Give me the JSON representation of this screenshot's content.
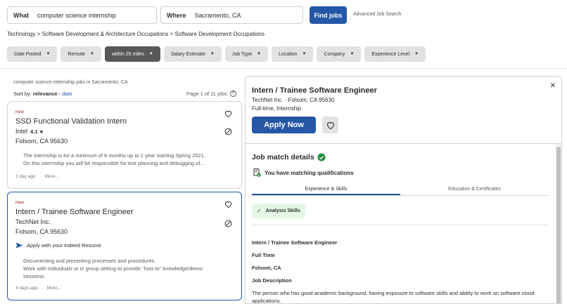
{
  "search": {
    "what_label": "What",
    "what_value": "computer science internship",
    "where_label": "Where",
    "where_value": "Sacramento, CA",
    "find_button": "Find jobs",
    "advanced_link": "Advanced Job Search"
  },
  "breadcrumb": "Technology > Software Development & Architecture Occupations > Software Development Occupations",
  "filters": [
    {
      "label": "Date Posted"
    },
    {
      "label": "Remote"
    },
    {
      "label": "within 25 miles"
    },
    {
      "label": "Salary Estimate"
    },
    {
      "label": "Job Type"
    },
    {
      "label": "Location"
    },
    {
      "label": "Company"
    },
    {
      "label": "Experience Level"
    }
  ],
  "results": {
    "title": "computer science internship jobs in Sacramento, CA",
    "sort_prefix": "Sort by:",
    "sort_active": "relevance",
    "sort_sep": " - ",
    "sort_alt": "date",
    "page_info": "Page 1 of 11 jobs"
  },
  "jobs": [
    {
      "new": "new",
      "title": "SSD Functional Validation Intern",
      "company": "Intel",
      "rating": "4.1 ★",
      "location": "Folsom, CA 95630",
      "bullets": [
        "The internship is for a minimum of 6 months up to 1 year starting Spring 2021.",
        "On this internship you will be responsible for test planning and debugging of…"
      ],
      "posted": "1 day ago",
      "more": "More..."
    },
    {
      "new": "new",
      "title": "Intern / Trainee Software Engineer",
      "company": "TechNet Inc.",
      "location": "Folsom, CA 95630",
      "apply_text": "Apply with your Indeed Resume",
      "bullets": [
        "Documenting and presenting processes and procedures.",
        "Work with individuals or in group setting to provide “how to” knowledge/demo",
        "sessions."
      ],
      "posted": "4 days ago",
      "more": "More..."
    }
  ],
  "panel": {
    "title": "Intern / Trainee Software Engineer",
    "company_location": "TechNet Inc. - Folsom, CA 95630",
    "job_type": "Full-time, Internship",
    "apply_button": "Apply Now",
    "match_title": "Job match details",
    "match_qualifications": "You have matching qualifications",
    "tabs": [
      "Experience & Skills",
      "Education & Certificates"
    ],
    "skill_chip": "Analysis Skills",
    "details": [
      "Intern / Trainee Software Engineer",
      "Full Time",
      "Folsom, CA",
      "Job Description"
    ],
    "description": "The person who has good academic background, having exposure to software skills and ability to work on software cloud applications."
  },
  "colors": {
    "brand_blue": "#2557a7",
    "new_red": "#a9252b",
    "match_green": "#1f8a3b"
  }
}
